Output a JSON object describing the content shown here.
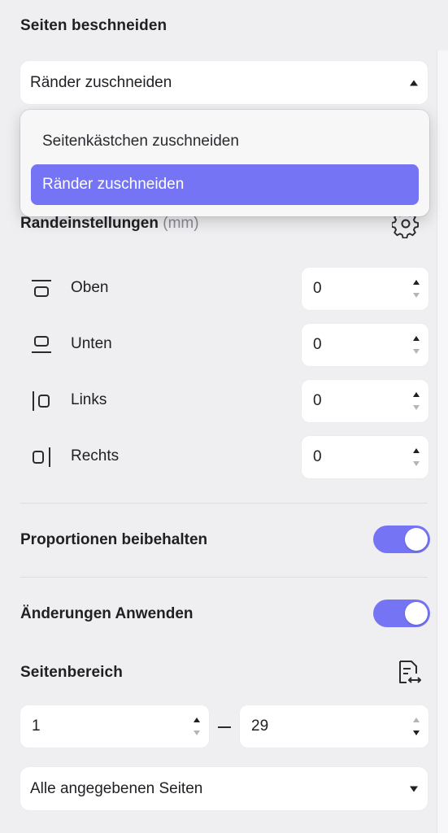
{
  "crop": {
    "title": "Seiten beschneiden",
    "mode_select": {
      "value": "Ränder zuschneiden"
    },
    "dropdown_options": [
      {
        "label": "Seitenkästchen zuschneiden",
        "selected": false
      },
      {
        "label": "Ränder zuschneiden",
        "selected": true
      }
    ]
  },
  "margins": {
    "title": "Randeinstellungen",
    "unit": "(mm)",
    "rows": [
      {
        "label": "Oben",
        "value": "0",
        "icon": "margin-top-icon"
      },
      {
        "label": "Unten",
        "value": "0",
        "icon": "margin-bottom-icon"
      },
      {
        "label": "Links",
        "value": "0",
        "icon": "margin-left-icon"
      },
      {
        "label": "Rechts",
        "value": "0",
        "icon": "margin-right-icon"
      }
    ]
  },
  "proportions": {
    "label": "Proportionen beibehalten",
    "on": true
  },
  "apply_changes": {
    "label": "Änderungen Anwenden",
    "on": true
  },
  "page_range": {
    "title": "Seitenbereich",
    "from": "1",
    "to": "29",
    "scope_select": {
      "value": "Alle angegebenen Seiten"
    }
  },
  "colors": {
    "accent": "#7474f5",
    "background": "#efeff1"
  }
}
